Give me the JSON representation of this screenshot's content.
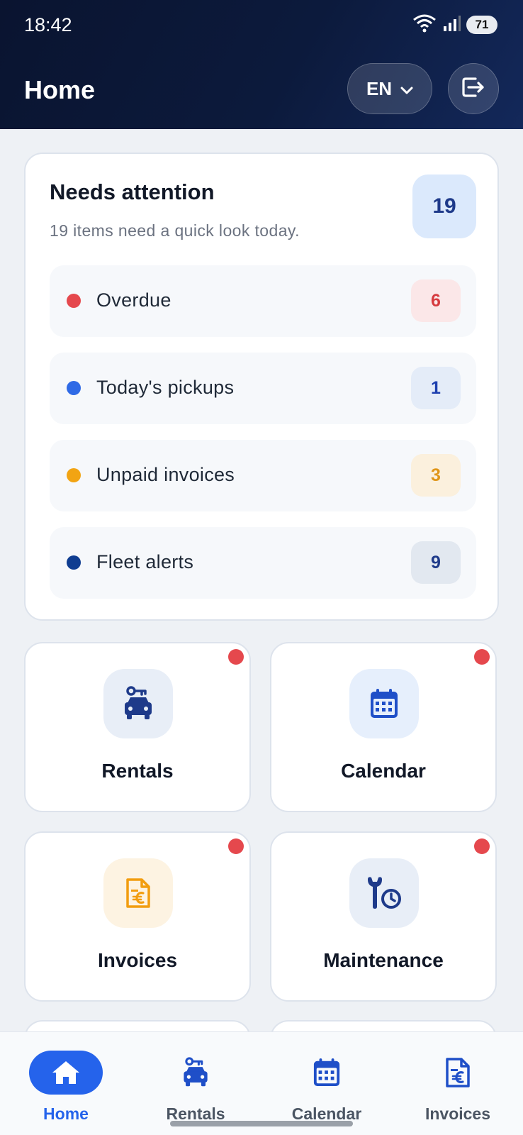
{
  "status_bar": {
    "time": "18:42",
    "battery": "71",
    "icons": [
      "wifi-icon",
      "signal-icon",
      "battery-icon"
    ]
  },
  "header": {
    "title": "Home",
    "language": "EN",
    "logout_icon": "logout-icon"
  },
  "attention": {
    "title": "Needs attention",
    "subtitle": "19 items need a quick look today.",
    "total": "19",
    "items": [
      {
        "label": "Overdue",
        "count": "6",
        "color": "#e5484d",
        "badge_bg": "#fbe7e8",
        "badge_fg": "#d63b3f"
      },
      {
        "label": "Today's pickups",
        "count": "1",
        "color": "#2f6ae6",
        "badge_bg": "#e4ecf8",
        "badge_fg": "#1e40af"
      },
      {
        "label": "Unpaid invoices",
        "count": "3",
        "color": "#f2a413",
        "badge_bg": "#fbf0dd",
        "badge_fg": "#e0961a"
      },
      {
        "label": "Fleet alerts",
        "count": "9",
        "color": "#0f3d91",
        "badge_bg": "#e2e8f0",
        "badge_fg": "#1e3a8a"
      }
    ]
  },
  "tiles": [
    {
      "label": "Rentals",
      "icon": "car-key-icon",
      "has_notification": true
    },
    {
      "label": "Calendar",
      "icon": "calendar-icon",
      "has_notification": true
    },
    {
      "label": "Invoices",
      "icon": "invoice-euro-icon",
      "has_notification": true
    },
    {
      "label": "Maintenance",
      "icon": "wrench-clock-icon",
      "has_notification": true
    }
  ],
  "bottom_nav": {
    "items": [
      {
        "label": "Home",
        "icon": "home-icon",
        "active": true
      },
      {
        "label": "Rentals",
        "icon": "car-key-icon",
        "active": false
      },
      {
        "label": "Calendar",
        "icon": "calendar-icon",
        "active": false
      },
      {
        "label": "Invoices",
        "icon": "invoice-euro-icon",
        "active": false
      }
    ]
  },
  "colors": {
    "accent": "#2563eb",
    "header_bg": "#0b1733",
    "notification": "#e5484d",
    "icon_blue": "#1e40af",
    "icon_orange": "#f29d0f"
  }
}
